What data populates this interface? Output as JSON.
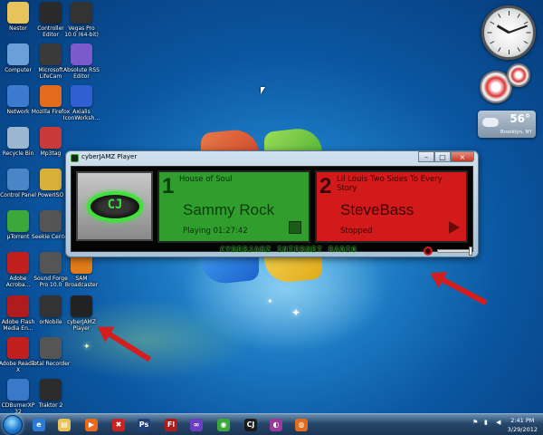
{
  "desktop": {
    "icons": [
      {
        "label": "Nestor",
        "icon": "folder-icon",
        "color": "#e8c25a"
      },
      {
        "label": "Controller Editor",
        "icon": "controller-icon",
        "color": "#2a2a2a"
      },
      {
        "label": "Vegas Pro 10.0 (64-bit)",
        "icon": "vegas-icon",
        "color": "#333333"
      },
      {
        "label": "Computer",
        "icon": "computer-icon",
        "color": "#6aa0d8"
      },
      {
        "label": "Microsoft LifeCam",
        "icon": "webcam-icon",
        "color": "#3a3a3a"
      },
      {
        "label": "Absolute RSS Editor",
        "icon": "rss-icon",
        "color": "#7b5bc9"
      },
      {
        "label": "Network",
        "icon": "network-icon",
        "color": "#3d7bd0"
      },
      {
        "label": "Mozilla Firefox",
        "icon": "firefox-icon",
        "color": "#e36b1e"
      },
      {
        "label": "Axialis IconWorksh...",
        "icon": "iconworkshop-icon",
        "color": "#2f5fd0"
      },
      {
        "label": "Recycle Bin",
        "icon": "recycle-bin-icon",
        "color": "#9ab7cf"
      },
      {
        "label": "Mp3tag",
        "icon": "mp3tag-icon",
        "color": "#c93a3a"
      },
      {
        "label": "Control Panel",
        "icon": "control-panel-icon",
        "color": "#4a86c7"
      },
      {
        "label": "PowerISO",
        "icon": "poweriso-icon",
        "color": "#d8b03a"
      },
      {
        "label": "µTorrent",
        "icon": "utorrent-icon",
        "color": "#3aa83a"
      },
      {
        "label": "Seekie Center",
        "icon": "seekie-icon",
        "color": "#555555"
      },
      {
        "label": "Adobe Acroba...",
        "icon": "acrobat-icon",
        "color": "#c21f1f"
      },
      {
        "label": "Sound Forge Pro 10.0",
        "icon": "soundforge-icon",
        "color": "#555555"
      },
      {
        "label": "SAM Broadcaster",
        "icon": "sam-broadcaster-icon",
        "color": "#e07a1a"
      },
      {
        "label": "Adobe Flash Media En...",
        "icon": "flash-media-icon",
        "color": "#b01c1c"
      },
      {
        "label": "orNobile",
        "icon": "ornobile-icon",
        "color": "#333333"
      },
      {
        "label": "cyberJAMZ Player",
        "icon": "cyberjamz-icon",
        "color": "#222222"
      },
      {
        "label": "Adobe Reader X",
        "icon": "adobe-reader-icon",
        "color": "#c21f1f"
      },
      {
        "label": "Total Recorder",
        "icon": "total-recorder-icon",
        "color": "#555555"
      },
      {
        "label": "CDBurnerXP 32",
        "icon": "cdburnerxp-icon",
        "color": "#3a78c8"
      },
      {
        "label": "Traktor 2",
        "icon": "traktor-icon",
        "color": "#2c2c2c"
      }
    ]
  },
  "gadgets": {
    "weather": {
      "temp": "56°",
      "location": "Brooklyn, NY"
    }
  },
  "player": {
    "window_title": "cyberJAMZ Player",
    "logo_text": "CJ",
    "minimize": "–",
    "maximize": "□",
    "close": "×",
    "channel1": {
      "number": "1",
      "show": "House of Soul",
      "dj": "Sammy Rock",
      "status": "Playing 01:27:42",
      "color": "#2f9e2c"
    },
    "channel2": {
      "number": "2",
      "show": "Lil Louis Two Sides To Every Story",
      "dj": "SteveBass",
      "status": "Stopped",
      "color": "#d31a1a"
    },
    "brand": "CYBERJAMZ INTERNET RADIO"
  },
  "taskbar": {
    "apps": [
      {
        "name": "ie-icon",
        "glyph": "e",
        "color": "#2a7bd8"
      },
      {
        "name": "explorer-icon",
        "glyph": "▤",
        "color": "#e8c25a"
      },
      {
        "name": "media-player-icon",
        "glyph": "▶",
        "color": "#e86a1a"
      },
      {
        "name": "tools-icon",
        "glyph": "✖",
        "color": "#c22"
      },
      {
        "name": "photoshop-icon",
        "glyph": "Ps",
        "color": "#1f3f78"
      },
      {
        "name": "flash-icon",
        "glyph": "Fl",
        "color": "#b01c1c"
      },
      {
        "name": "glasses-icon",
        "glyph": "∞",
        "color": "#6a3fc0"
      },
      {
        "name": "chrome-icon",
        "glyph": "◉",
        "color": "#3aa83a"
      },
      {
        "name": "cyberjamz-icon",
        "glyph": "CJ",
        "color": "#1b1b1b"
      },
      {
        "name": "media-icon",
        "glyph": "◐",
        "color": "#9a3a9a"
      },
      {
        "name": "firefox-icon",
        "glyph": "◍",
        "color": "#e36b1e"
      }
    ],
    "time": "2:41 PM",
    "date": "3/29/2012"
  }
}
